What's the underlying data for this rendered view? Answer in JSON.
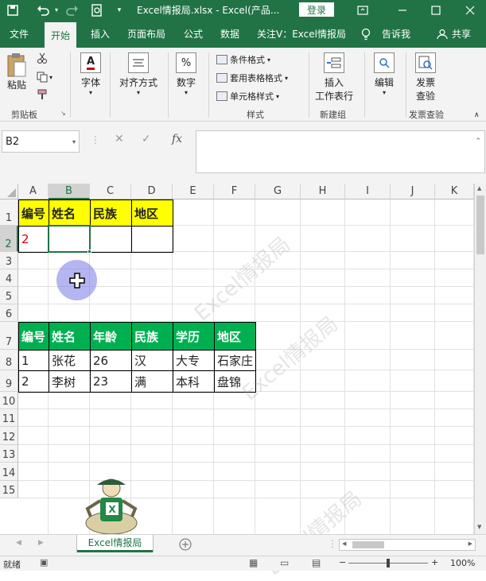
{
  "titlebar": {
    "title": "Excel情报局.xlsx  -  Excel(产品...",
    "login": "登录",
    "save_icon": "save-icon",
    "undo_icon": "undo-icon",
    "redo_icon": "redo-icon",
    "preview_icon": "print-preview-icon"
  },
  "menu": {
    "file": "文件",
    "home": "开始",
    "insert": "插入",
    "layout": "页面布局",
    "formulas": "公式",
    "data": "数据",
    "follow": "关注V：Excel情报局",
    "tell": "告诉我",
    "share": "共享"
  },
  "ribbon": {
    "paste": "粘贴",
    "clipboard": "剪贴板",
    "font": "字体",
    "align": "对齐方式",
    "number": "数字",
    "cond_format": "条件格式",
    "table_format": "套用表格格式",
    "cell_style": "单元格样式",
    "styles": "样式",
    "insert_sheet": "插入\n工作表行",
    "insert_line1": "插入",
    "insert_line2": "工作表行",
    "new_group": "新建组",
    "edit": "编辑",
    "invoice_line1": "发票",
    "invoice_line2": "查验",
    "invoice_group": "发票查验"
  },
  "formula": {
    "namebox": "B2",
    "fx": "fx",
    "value": ""
  },
  "columns": [
    "A",
    "B",
    "C",
    "D",
    "E",
    "F",
    "G",
    "H",
    "I",
    "J",
    "K"
  ],
  "rows": [
    "1",
    "2",
    "3",
    "4",
    "5",
    "6",
    "7",
    "8",
    "9",
    "10",
    "11",
    "12",
    "13",
    "14",
    "15"
  ],
  "table1": {
    "headers": [
      "编号",
      "姓名",
      "民族",
      "地区"
    ],
    "row2_a": "2"
  },
  "table2": {
    "headers": [
      "编号",
      "姓名",
      "年龄",
      "民族",
      "学历",
      "地区"
    ],
    "rows": [
      [
        "1",
        "张花",
        "26",
        "汉",
        "大专",
        "石家庄"
      ],
      [
        "2",
        "李树",
        "23",
        "满",
        "本科",
        "盘锦"
      ]
    ]
  },
  "watermark": "Excel情报局",
  "sheet": {
    "tab": "Excel情报局",
    "add_icon": "plus-circle-icon"
  },
  "status": {
    "ready": "就绪",
    "zoom": "100%"
  },
  "colors": {
    "brand": "#217346",
    "yellow": "#ffff00",
    "green": "#00b050"
  }
}
